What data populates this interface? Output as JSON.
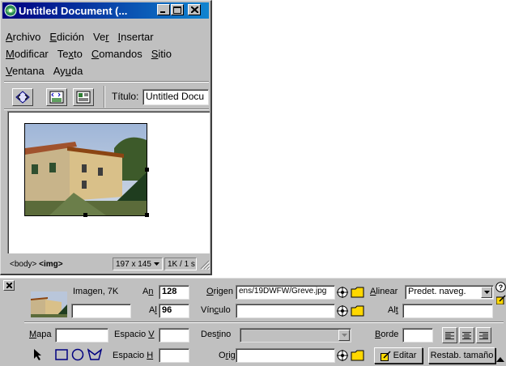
{
  "window": {
    "title": "Untitled Document (...",
    "menu_row1": [
      {
        "pre": "",
        "key": "A",
        "post": "rchivo"
      },
      {
        "pre": "",
        "key": "E",
        "post": "dición"
      },
      {
        "pre": "Ve",
        "key": "r",
        "post": ""
      },
      {
        "pre": "",
        "key": "I",
        "post": "nsertar"
      }
    ],
    "menu_row2": [
      {
        "pre": "",
        "key": "M",
        "post": "odificar"
      },
      {
        "pre": "Te",
        "key": "x",
        "post": "to"
      },
      {
        "pre": "",
        "key": "C",
        "post": "omandos"
      },
      {
        "pre": "",
        "key": "S",
        "post": "itio"
      }
    ],
    "menu_row3": [
      {
        "pre": "",
        "key": "V",
        "post": "entana"
      },
      {
        "pre": "Ay",
        "key": "u",
        "post": "da"
      }
    ],
    "toolbar": {
      "title_label": "Título:",
      "title_value": "Untitled Docu"
    },
    "status": {
      "tag_body": "<body>",
      "tag_img": "<img>",
      "size": "197 x 145",
      "download": "1K / 1 s"
    }
  },
  "inspector": {
    "element_type": "Imagen, 7K",
    "name_value": "",
    "width_label_pre": "A",
    "width_label_key": "n",
    "width_value": "128",
    "height_label_pre": "A",
    "height_label_key": "l",
    "height_value": "96",
    "src_label_key": "O",
    "src_label_post": "rigen",
    "src_value": "ens/19DWFW/Greve.jpg",
    "link_label_pre": "Vín",
    "link_label_key": "c",
    "link_label_post": "ulo",
    "link_value": "",
    "align_label_key": "A",
    "align_label_post": "linear",
    "align_value": "Predet. naveg.",
    "alt_label_pre": "Al",
    "alt_label_key": "t",
    "alt_value": "",
    "map_label_key": "M",
    "map_label_post": "apa",
    "map_value": "",
    "vspace_label_pre": "Espacio ",
    "vspace_label_key": "V",
    "vspace_value": "",
    "target_label_pre": "Des",
    "target_label_key": "t",
    "target_label_post": "ino",
    "target_value": "",
    "border_label_key": "B",
    "border_label_post": "orde",
    "border_value": "",
    "hspace_label_pre": "Espacio ",
    "hspace_label_key": "H",
    "hspace_value": "",
    "lowsrc_label_pre": "O",
    "lowsrc_label_key": "r",
    "lowsrc_label_post": "ig",
    "lowsrc_value": "",
    "edit_button": "Editar",
    "reset_size_button": "Restab. tamaño",
    "help_glyph": "?"
  },
  "colors": {
    "titlebar_start": "#000080",
    "titlebar_end": "#1084d0",
    "face": "#c0c0c0",
    "folder": "#ffd800"
  },
  "icons": [
    "app-icon",
    "minimize-icon",
    "maximize-icon",
    "close-icon",
    "code-view-icon",
    "split-view-icon",
    "design-view-icon",
    "resize-grip-icon",
    "collapse-icon",
    "point-to-file-icon",
    "folder-icon",
    "pointer-tool-icon",
    "rect-hotspot-icon",
    "circle-hotspot-icon",
    "polygon-hotspot-icon",
    "align-left-icon",
    "align-center-icon",
    "align-right-icon",
    "help-icon",
    "edit-icon"
  ]
}
